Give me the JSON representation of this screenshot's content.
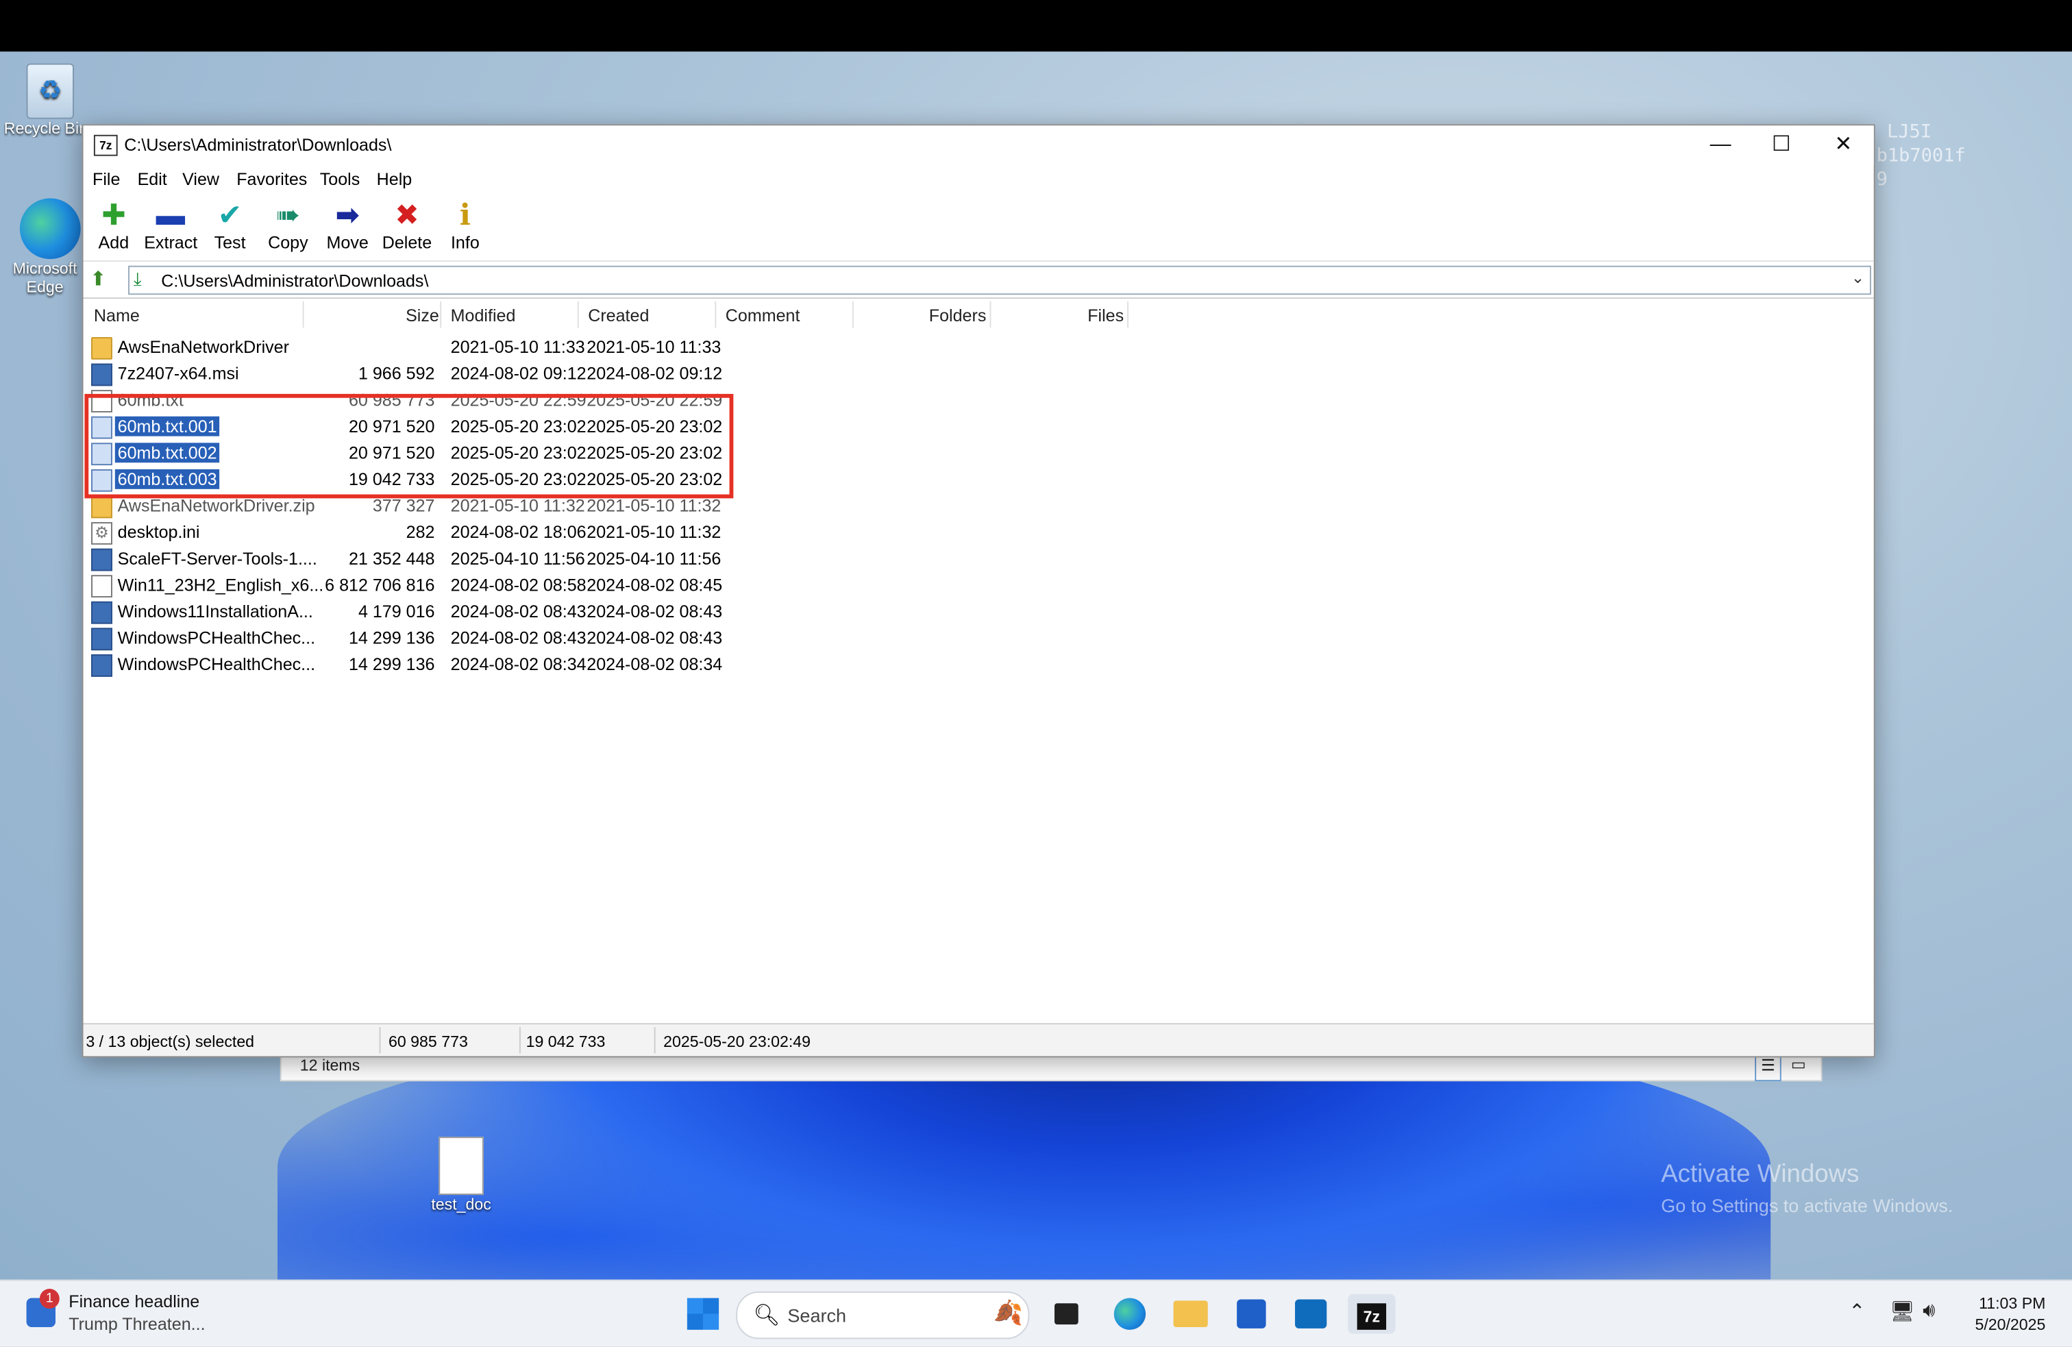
{
  "desktop": {
    "icons": [
      {
        "label": "Recycle Bin"
      },
      {
        "label": "Microsoft Edge"
      },
      {
        "label": "test_doc"
      }
    ],
    "watermark_lines": [
      "LJ5I",
      "b1b7001f",
      "9"
    ],
    "activate_title": "Activate Windows",
    "activate_sub": "Go to Settings to activate Windows."
  },
  "bg_explorer": {
    "items": "12 items"
  },
  "window": {
    "title": "C:\\Users\\Administrator\\Downloads\\",
    "menu": [
      "File",
      "Edit",
      "View",
      "Favorites",
      "Tools",
      "Help"
    ],
    "toolbar": [
      {
        "label": "Add",
        "icon": "add-icon"
      },
      {
        "label": "Extract",
        "icon": "extract-icon"
      },
      {
        "label": "Test",
        "icon": "test-icon"
      },
      {
        "label": "Copy",
        "icon": "copy-icon"
      },
      {
        "label": "Move",
        "icon": "move-icon"
      },
      {
        "label": "Delete",
        "icon": "delete-icon"
      },
      {
        "label": "Info",
        "icon": "info-icon"
      }
    ],
    "address": "C:\\Users\\Administrator\\Downloads\\",
    "columns": [
      "Name",
      "Size",
      "Modified",
      "Created",
      "Comment",
      "Folders",
      "Files"
    ],
    "rows": [
      {
        "name": "AwsEnaNetworkDriver",
        "size": "",
        "modified": "2021-05-10 11:33",
        "created": "2021-05-10 11:33",
        "type": "folder"
      },
      {
        "name": "7z2407-x64.msi",
        "size": "1 966 592",
        "modified": "2024-08-02 09:12",
        "created": "2024-08-02 09:12",
        "type": "msi"
      },
      {
        "name": "60mb.txt",
        "size": "60 985 773",
        "modified": "2025-05-20 22:59",
        "created": "2025-05-20 22:59",
        "type": "txt"
      },
      {
        "name": "60mb.txt.001",
        "size": "20 971 520",
        "modified": "2025-05-20 23:02",
        "created": "2025-05-20 23:02",
        "type": "txt",
        "selected": true
      },
      {
        "name": "60mb.txt.002",
        "size": "20 971 520",
        "modified": "2025-05-20 23:02",
        "created": "2025-05-20 23:02",
        "type": "txt",
        "selected": true
      },
      {
        "name": "60mb.txt.003",
        "size": "19 042 733",
        "modified": "2025-05-20 23:02",
        "created": "2025-05-20 23:02",
        "type": "txt",
        "selected": true
      },
      {
        "name": "AwsEnaNetworkDriver.zip",
        "size": "377 327",
        "modified": "2021-05-10 11:32",
        "created": "2021-05-10 11:32",
        "type": "zip"
      },
      {
        "name": "desktop.ini",
        "size": "282",
        "modified": "2024-08-02 18:06",
        "created": "2021-05-10 11:32",
        "type": "ini"
      },
      {
        "name": "ScaleFT-Server-Tools-1....",
        "size": "21 352 448",
        "modified": "2025-04-10 11:56",
        "created": "2025-04-10 11:56",
        "type": "msi"
      },
      {
        "name": "Win11_23H2_English_x6...",
        "size": "6 812 706 816",
        "modified": "2024-08-02 08:58",
        "created": "2024-08-02 08:45",
        "type": "txt"
      },
      {
        "name": "Windows11InstallationA...",
        "size": "4 179 016",
        "modified": "2024-08-02 08:43",
        "created": "2024-08-02 08:43",
        "type": "msi"
      },
      {
        "name": "WindowsPCHealthChec...",
        "size": "14 299 136",
        "modified": "2024-08-02 08:43",
        "created": "2024-08-02 08:43",
        "type": "msi"
      },
      {
        "name": "WindowsPCHealthChec...",
        "size": "14 299 136",
        "modified": "2024-08-02 08:34",
        "created": "2024-08-02 08:34",
        "type": "msi"
      }
    ],
    "status": {
      "selected": "3 / 13 object(s) selected",
      "total_size": "60 985 773",
      "size2": "19 042 733",
      "date": "2025-05-20 23:02:49"
    }
  },
  "taskbar": {
    "news_badge": "1",
    "news_title": "Finance headline",
    "news_sub": "Trump Threaten...",
    "search_placeholder": "Search",
    "time": "11:03 PM",
    "date": "5/20/2025"
  }
}
